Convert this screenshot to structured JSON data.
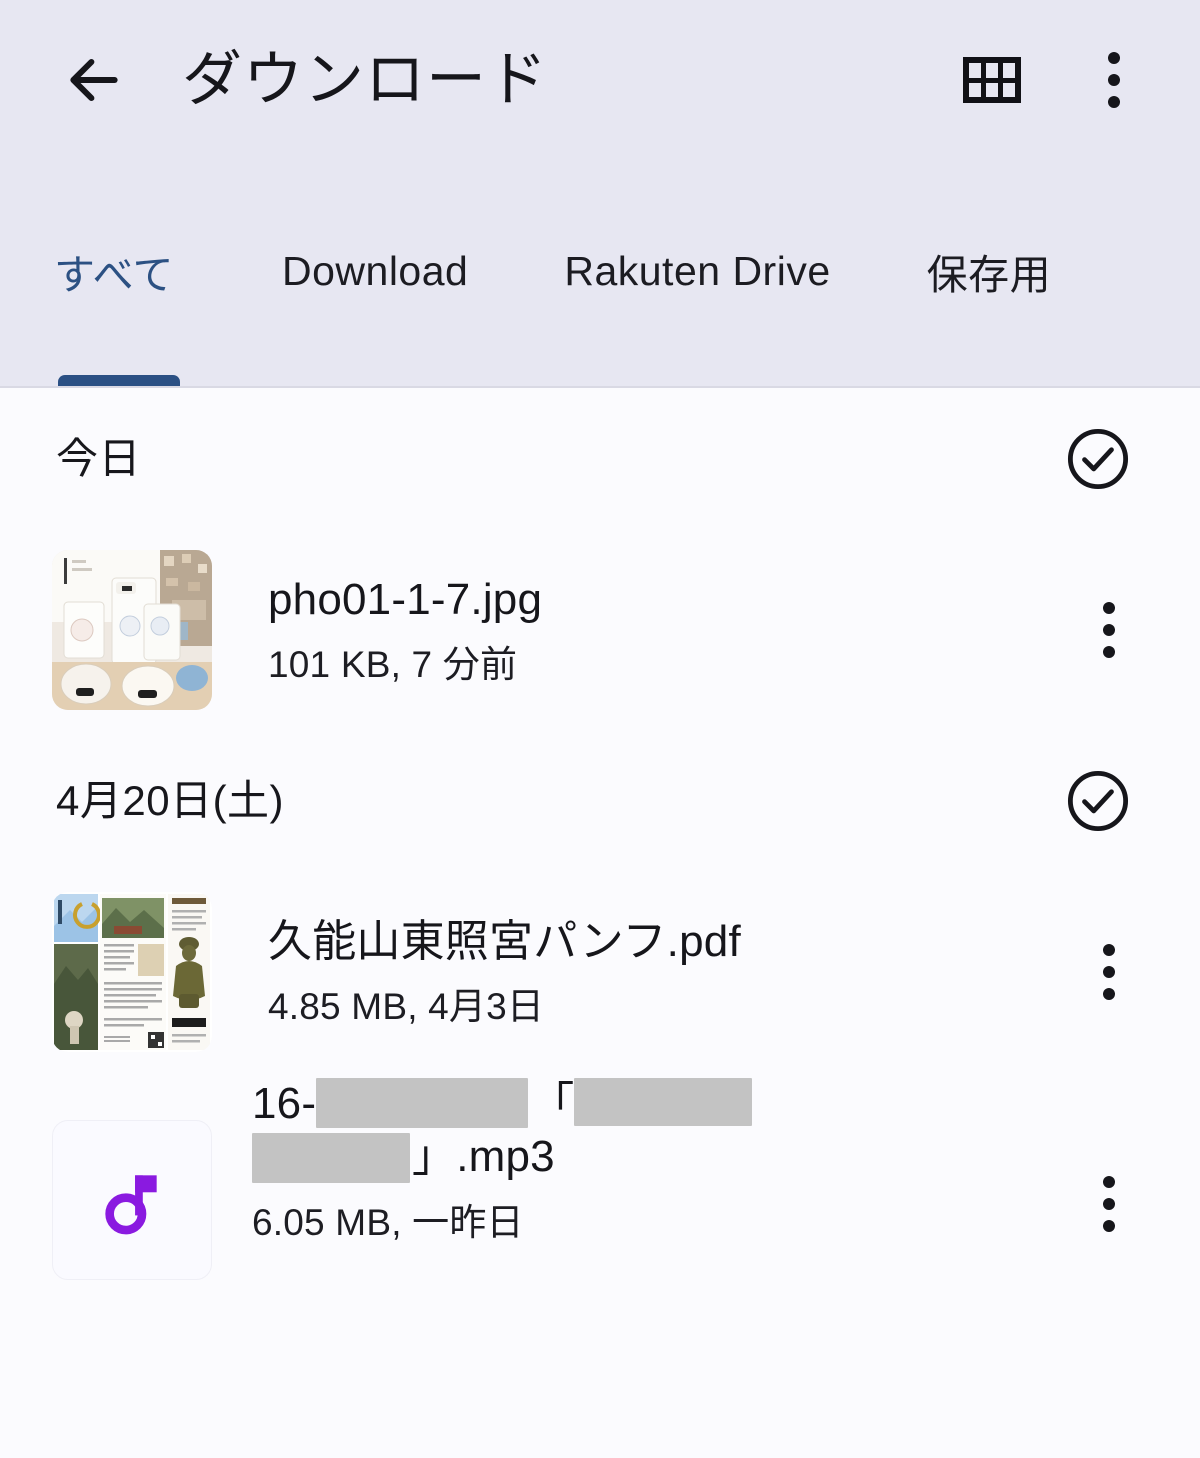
{
  "appbar": {
    "title": "ダウンロード",
    "back_icon": "back-arrow-icon",
    "grid_icon": "grid-view-icon",
    "overflow_icon": "more-vert-icon"
  },
  "tabs": [
    {
      "label": "すべて",
      "active": true
    },
    {
      "label": "Download",
      "active": false
    },
    {
      "label": "Rakuten Drive",
      "active": false
    },
    {
      "label": "保存用",
      "active": false
    }
  ],
  "sections": [
    {
      "title": "今日",
      "select_icon": "check-circle-icon",
      "files": [
        {
          "name": "pho01-1-7.jpg",
          "sub": "101 KB, 7 分前",
          "thumb_type": "photo",
          "menu_icon": "more-vert-icon"
        }
      ]
    },
    {
      "title": "4月20日(土)",
      "select_icon": "check-circle-icon",
      "files": [
        {
          "name": "久能山東照宮パンフ.pdf",
          "sub": "4.85 MB, 4月3日",
          "thumb_type": "pdf",
          "menu_icon": "more-vert-icon"
        },
        {
          "name_prefix": "16-",
          "name_bracket_open": "「",
          "name_bracket_close": "」",
          "name_suffix": ".mp3",
          "sub": "6.05 MB, 一昨日",
          "thumb_type": "audio",
          "thumb_icon": "music-note-icon",
          "menu_icon": "more-vert-icon",
          "redacted": true
        }
      ]
    }
  ],
  "colors": {
    "appbar_bg": "#e7e7f2",
    "content_bg": "#fbfbfe",
    "accent": "#2b5084",
    "text": "#16161b",
    "music_note": "#8a1ae0",
    "redaction": "#c3c3c3"
  }
}
